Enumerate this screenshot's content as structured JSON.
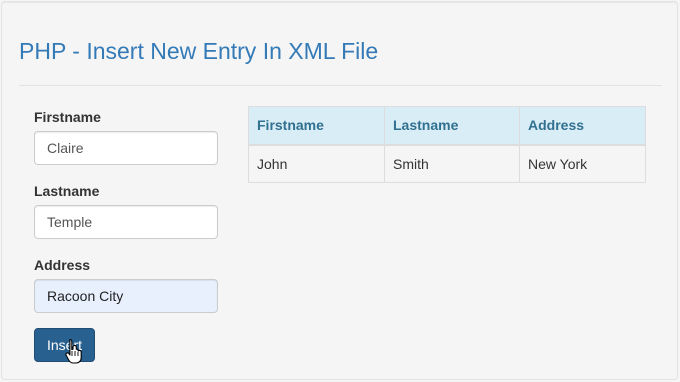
{
  "page": {
    "title": "PHP - Insert New Entry In XML File"
  },
  "form": {
    "firstname_label": "Firstname",
    "firstname_value": "Claire",
    "lastname_label": "Lastname",
    "lastname_value": "Temple",
    "address_label": "Address",
    "address_value": "Racoon City",
    "submit_label": "Insert"
  },
  "table": {
    "headers": [
      "Firstname",
      "Lastname",
      "Address"
    ],
    "rows": [
      [
        "John",
        "Smith",
        "New York"
      ]
    ]
  },
  "colors": {
    "title": "#337ab7",
    "header_bg": "#d9edf7",
    "header_text": "#31708f",
    "button_bg": "#286090"
  },
  "icons": {
    "cursor": "hand-pointer-icon"
  }
}
